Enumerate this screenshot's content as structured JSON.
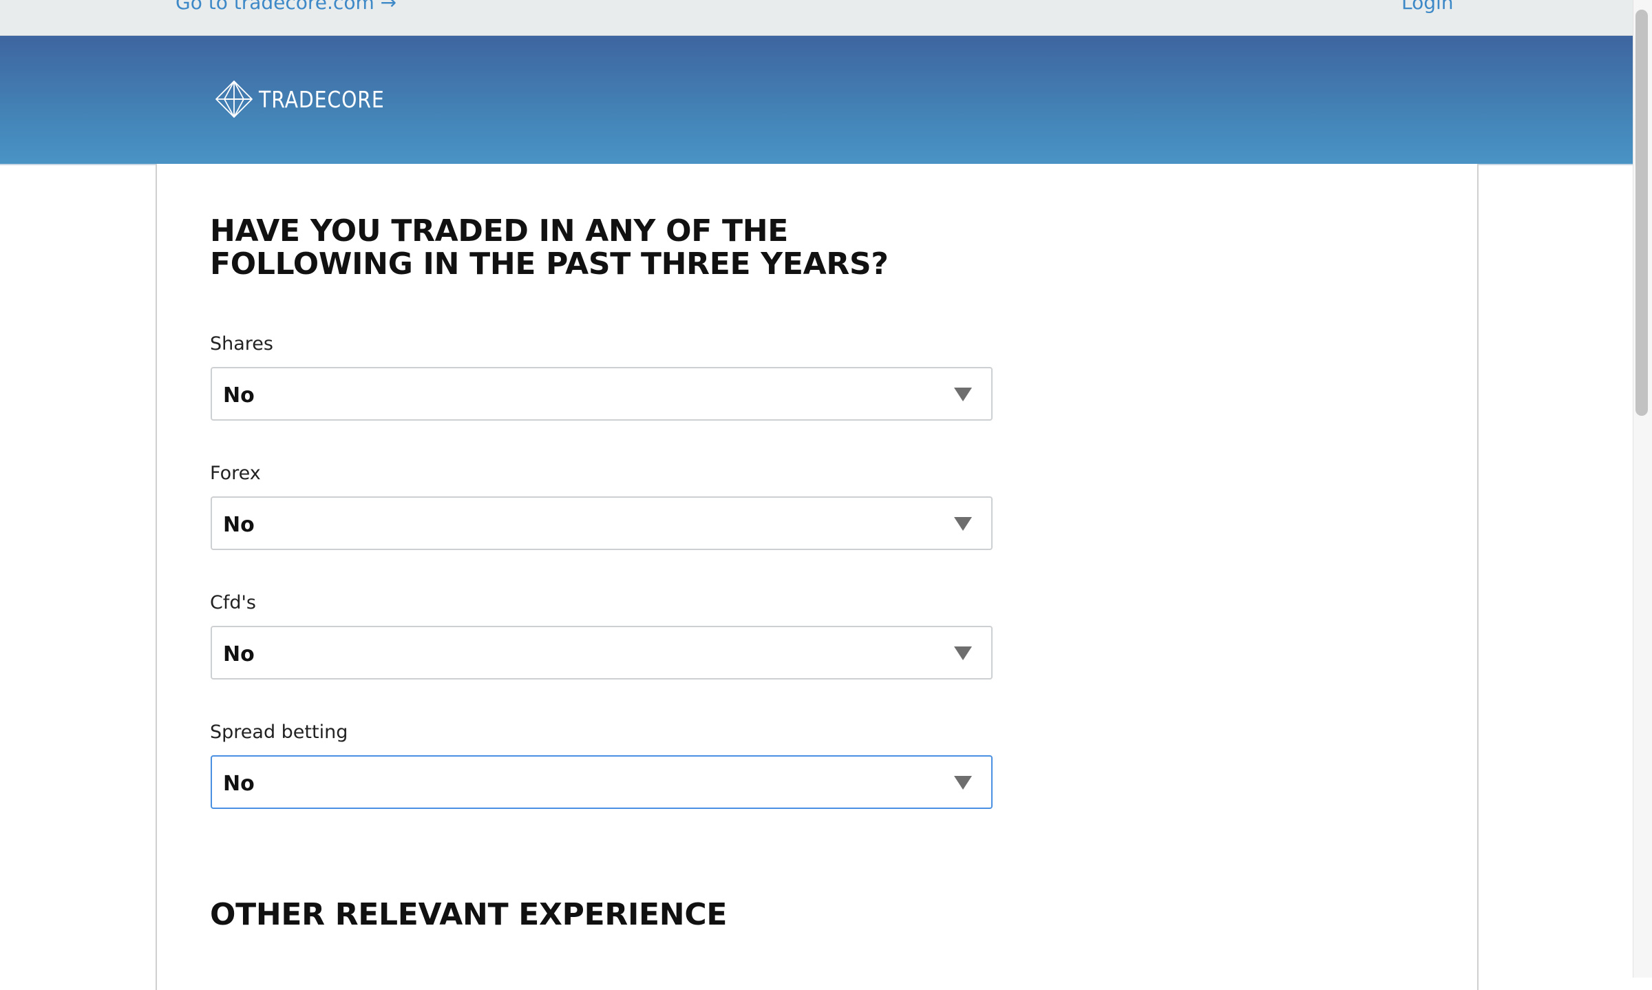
{
  "topbar": {
    "goto_link": "Go to tradecore.com →",
    "login_link": "Login"
  },
  "header": {
    "logo_text": "TRADECORE"
  },
  "form": {
    "question_heading": "HAVE YOU TRADED IN ANY OF THE FOLLOWING IN THE PAST THREE YEARS?",
    "fields": [
      {
        "label": "Shares",
        "value": "No"
      },
      {
        "label": "Forex",
        "value": "No"
      },
      {
        "label": "Cfd's",
        "value": "No"
      },
      {
        "label": "Spread betting",
        "value": "No"
      }
    ],
    "other_heading": "OTHER RELEVANT EXPERIENCE"
  },
  "colors": {
    "link": "#3d88c7",
    "header_top": "#3e659f",
    "header_bottom": "#4a93c5",
    "focus_border": "#4a90e2"
  },
  "icons": {
    "logo": "tradecore-diamond-icon",
    "dropdown": "triangle-down-icon"
  }
}
